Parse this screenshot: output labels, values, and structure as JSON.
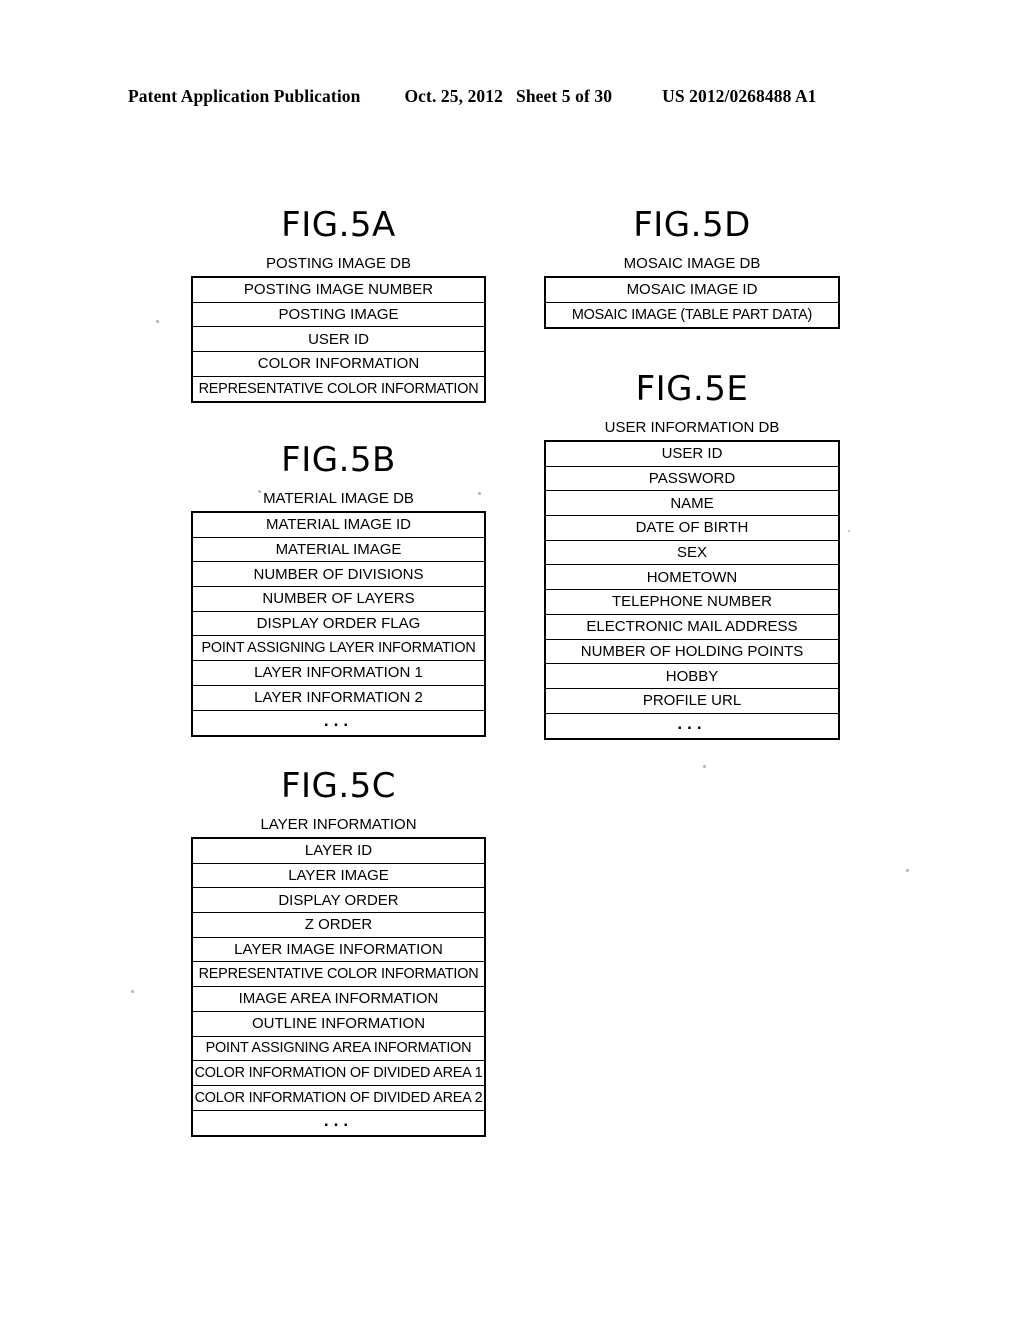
{
  "header": {
    "publication": "Patent Application Publication",
    "date": "Oct. 25, 2012",
    "sheet": "Sheet 5 of 30",
    "number": "US 2012/0268488 A1"
  },
  "figures": [
    {
      "id": "fig5a",
      "title": "FIG.5A",
      "caption": "POSTING IMAGE DB",
      "rows": [
        "POSTING IMAGE NUMBER",
        "POSTING IMAGE",
        "USER ID",
        "COLOR INFORMATION",
        "REPRESENTATIVE COLOR INFORMATION"
      ],
      "has_ellipsis": false,
      "ellipsis": ""
    },
    {
      "id": "fig5b",
      "title": "FIG.5B",
      "caption": "MATERIAL IMAGE DB",
      "rows": [
        "MATERIAL IMAGE ID",
        "MATERIAL IMAGE",
        "NUMBER OF DIVISIONS",
        "NUMBER OF LAYERS",
        "DISPLAY ORDER FLAG",
        "POINT ASSIGNING LAYER INFORMATION",
        "LAYER INFORMATION 1",
        "LAYER INFORMATION 2"
      ],
      "has_ellipsis": true,
      "ellipsis": "..."
    },
    {
      "id": "fig5c",
      "title": "FIG.5C",
      "caption": "LAYER INFORMATION",
      "rows": [
        "LAYER ID",
        "LAYER IMAGE",
        "DISPLAY ORDER",
        "Z ORDER",
        "LAYER IMAGE INFORMATION",
        "REPRESENTATIVE COLOR INFORMATION",
        "IMAGE AREA INFORMATION",
        "OUTLINE INFORMATION",
        "POINT ASSIGNING AREA INFORMATION",
        "COLOR INFORMATION OF DIVIDED AREA 1",
        "COLOR INFORMATION OF DIVIDED AREA 2"
      ],
      "has_ellipsis": true,
      "ellipsis": "..."
    },
    {
      "id": "fig5d",
      "title": "FIG.5D",
      "caption": "MOSAIC IMAGE DB",
      "rows": [
        "MOSAIC IMAGE ID",
        "MOSAIC IMAGE (TABLE PART DATA)"
      ],
      "has_ellipsis": false,
      "ellipsis": ""
    },
    {
      "id": "fig5e",
      "title": "FIG.5E",
      "caption": "USER INFORMATION DB",
      "rows": [
        "USER ID",
        "PASSWORD",
        "NAME",
        "DATE OF BIRTH",
        "SEX",
        "HOMETOWN",
        "TELEPHONE NUMBER",
        "ELECTRONIC MAIL ADDRESS",
        "NUMBER OF HOLDING POINTS",
        "HOBBY",
        "PROFILE URL"
      ],
      "has_ellipsis": true,
      "ellipsis": "..."
    }
  ]
}
